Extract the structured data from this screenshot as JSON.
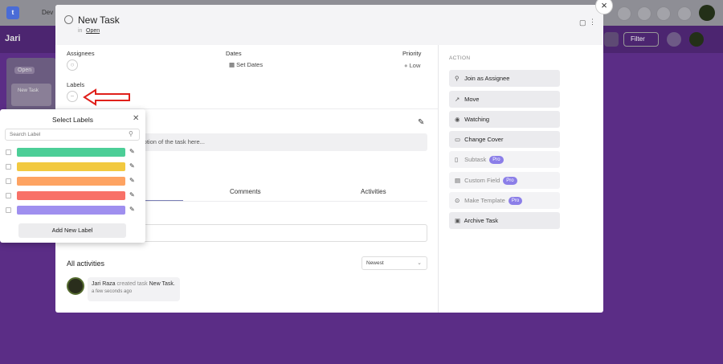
{
  "background": {
    "board_title": "Jari",
    "workspace_name": "Dev",
    "filter_label": "Filter",
    "column": {
      "title": "Open",
      "card": "New Task"
    }
  },
  "task": {
    "title": "New Task",
    "in_label": "in",
    "list_name": "Open"
  },
  "fields": {
    "assignees_label": "Assignees",
    "dates_label": "Dates",
    "set_dates": "Set Dates",
    "priority_label": "Priority",
    "priority_value": "Low",
    "labels_label": "Labels"
  },
  "description": {
    "placeholder": "iption of the task here..."
  },
  "tabs": [
    {
      "label": "Comments"
    },
    {
      "label": "Activities"
    }
  ],
  "activities": {
    "heading": "All activities",
    "sort": "Newest",
    "items": [
      {
        "user": "Jari Raza",
        "action": "created task",
        "target": "New Task.",
        "time": "a few seconds ago"
      }
    ]
  },
  "action_panel": {
    "heading": "ACTION",
    "buttons": [
      {
        "label": "Join as Assignee",
        "icon": "user-icon",
        "pro": false
      },
      {
        "label": "Move",
        "icon": "arrow-icon",
        "pro": false
      },
      {
        "label": "Watching",
        "icon": "eye-icon",
        "pro": false
      },
      {
        "label": "Change Cover",
        "icon": "image-icon",
        "pro": false
      },
      {
        "label": "Subtask",
        "icon": "subtask-icon",
        "pro": true
      },
      {
        "label": "Custom Field",
        "icon": "field-icon",
        "pro": true
      },
      {
        "label": "Make Template",
        "icon": "template-icon",
        "pro": true
      },
      {
        "label": "Archive Task",
        "icon": "archive-icon",
        "pro": false
      }
    ],
    "pro_badge": "Pro"
  },
  "label_popup": {
    "title": "Select Labels",
    "search_placeholder": "Search Label",
    "labels": [
      {
        "color": "#4cce97"
      },
      {
        "color": "#f2c940"
      },
      {
        "color": "#fea362"
      },
      {
        "color": "#f87168"
      },
      {
        "color": "#9f8fef"
      }
    ],
    "add_button": "Add New Label"
  }
}
